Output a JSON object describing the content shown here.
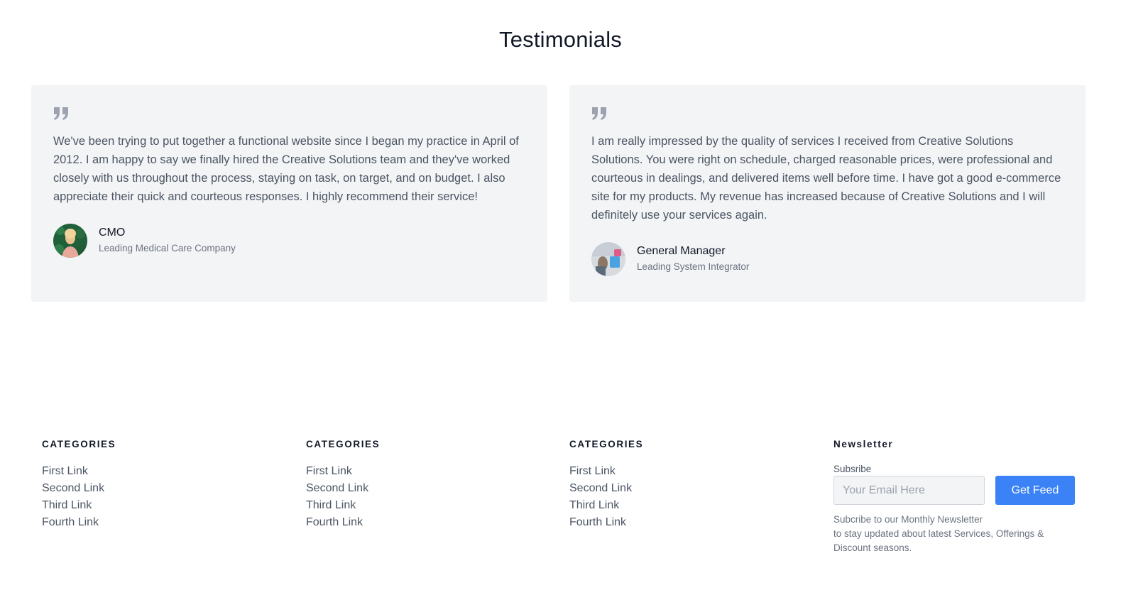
{
  "testimonials": {
    "title": "Testimonials",
    "items": [
      {
        "text": "We've been trying to put together a functional website since I began my practice in April of 2012. I am happy to say we finally hired the Creative Solutions team and they've worked closely with us throughout the process, staying on task, on target, and on budget. I also appreciate their quick and courteous responses. I highly recommend their service!",
        "name": "CMO",
        "role": "Leading Medical Care Company"
      },
      {
        "text": "I am really impressed by the quality of services I received from Creative Solutions Solutions. You were right on schedule, charged reasonable prices, were professional and courteous in dealings, and delivered items well before time. I have got a good e-commerce site for my products. My revenue has increased because of Creative Solutions and I will definitely use your services again.",
        "name": "General Manager",
        "role": "Leading System Integrator"
      }
    ]
  },
  "footer": {
    "columns": [
      {
        "heading": "CATEGORIES",
        "links": [
          "First Link",
          "Second Link",
          "Third Link",
          "Fourth Link"
        ]
      },
      {
        "heading": "CATEGORIES",
        "links": [
          "First Link",
          "Second Link",
          "Third Link",
          "Fourth Link"
        ]
      },
      {
        "heading": "CATEGORIES",
        "links": [
          "First Link",
          "Second Link",
          "Third Link",
          "Fourth Link"
        ]
      }
    ],
    "newsletter": {
      "heading": "Newsletter",
      "label": "Subsribe",
      "placeholder": "Your Email Here",
      "button": "Get Feed",
      "description_lines": [
        "Subcribe to our Monthly Newsletter",
        "to stay updated about latest Services, Offerings &",
        "Discount seasons."
      ]
    }
  },
  "colors": {
    "accent": "#3b82f6",
    "card_bg": "#f3f4f6",
    "quote_icon": "#9ca3af"
  }
}
